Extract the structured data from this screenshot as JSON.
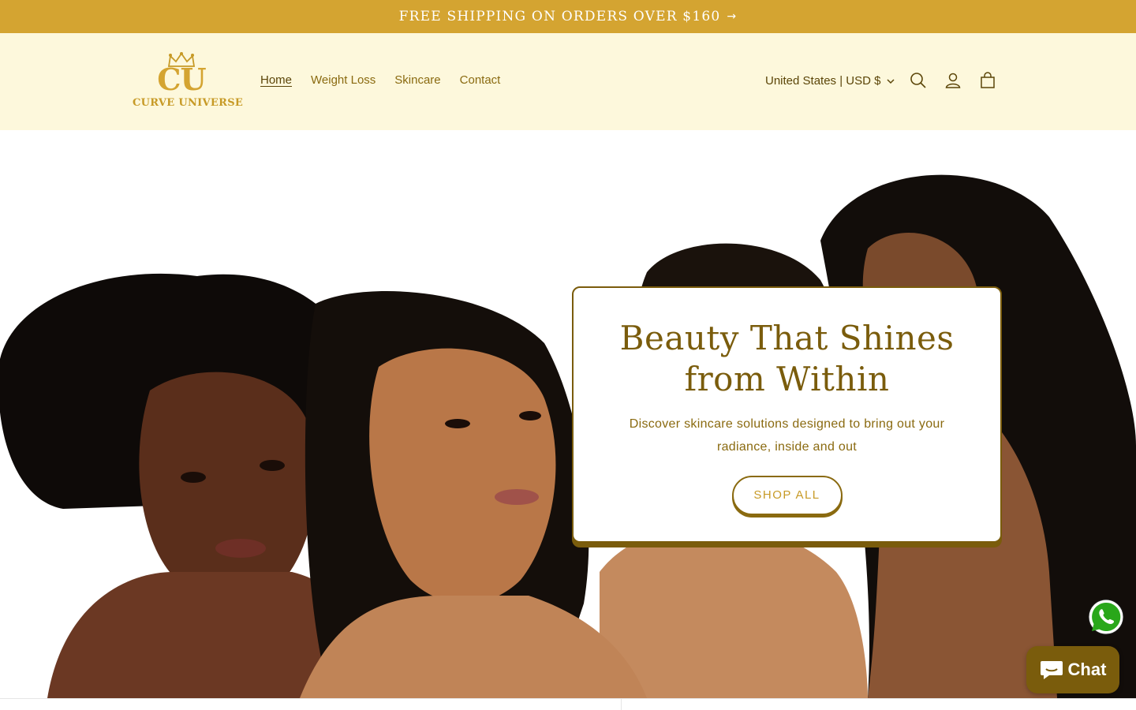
{
  "announcement": {
    "text": "FREE SHIPPING ON ORDERS OVER $160",
    "arrow": "→"
  },
  "logo": {
    "monogram": "CU",
    "wordmark": "CURVE UNIVERSE"
  },
  "nav": {
    "items": [
      "Home",
      "Weight Loss",
      "Skincare",
      "Contact"
    ],
    "active": "Home"
  },
  "header": {
    "locale": "United States | USD $",
    "icons": [
      "search-icon",
      "account-icon",
      "cart-icon"
    ]
  },
  "hero": {
    "title_line1": "Beauty That Shines",
    "title_line2": "from Within",
    "subtitle_line1": "Discover skincare solutions designed to bring out your",
    "subtitle_line2": "radiance, inside and out",
    "button": "SHOP ALL"
  },
  "widgets": {
    "chat_label": "Chat",
    "whatsapp_icon": "whatsapp-icon"
  },
  "colors": {
    "gold": "#d4a431",
    "brown": "#7a5c0c",
    "cream": "#fdf8dc"
  }
}
